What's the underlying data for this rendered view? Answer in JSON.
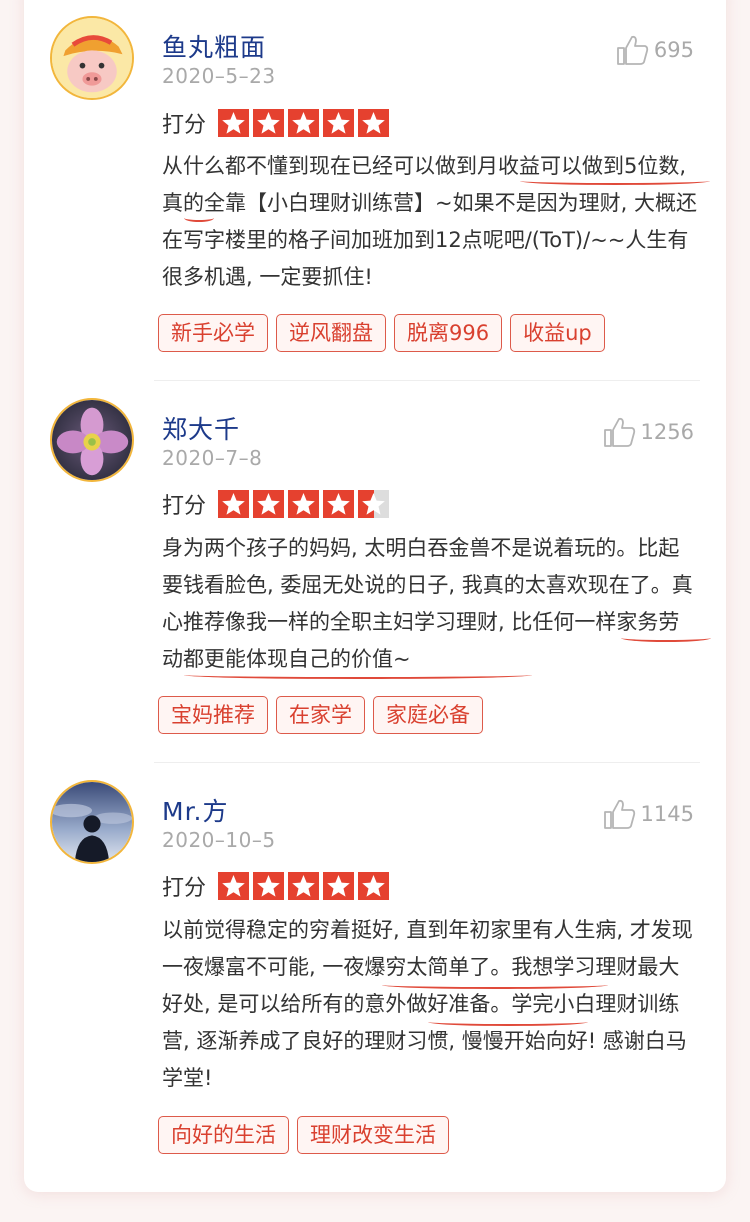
{
  "reviews": [
    {
      "name": "鱼丸粗面",
      "date": "2020–5–23",
      "likes": "695",
      "rating_label": "打分",
      "rating": 5,
      "avatar": "cartoon-pig-avatar",
      "text": "从什么都不懂到现在已经可以做到月收益可以做到5位数, 真的全靠【小白理财训练营】~如果不是因为理财, 大概还在写字楼里的格子间加班加到12点呢吧/(ToT)/~~人生有很多机遇, 一定要抓住!",
      "tags": [
        "新手必学",
        "逆风翻盘",
        "脱离996",
        "收益up"
      ]
    },
    {
      "name": "郑大千",
      "date": "2020–7–8",
      "likes": "1256",
      "rating_label": "打分",
      "rating": 4.5,
      "avatar": "purple-flower-avatar",
      "text": "身为两个孩子的妈妈, 太明白吞金兽不是说着玩的。比起要钱看脸色, 委屈无处说的日子, 我真的太喜欢现在了。真心推荐像我一样的全职主妇学习理财, 比任何一样家务劳动都更能体现自己的价值~",
      "tags": [
        "宝妈推荐",
        "在家学",
        "家庭必备"
      ]
    },
    {
      "name": "Mr.方",
      "date": "2020–10–5",
      "likes": "1145",
      "rating_label": "打分",
      "rating": 5,
      "avatar": "silhouette-sky-avatar",
      "text": "以前觉得稳定的穷着挺好, 直到年初家里有人生病, 才发现一夜爆富不可能, 一夜爆穷太简单了。我想学习理财最大好处, 是可以给所有的意外做好准备。学完小白理财训练营, 逐渐养成了良好的理财习惯, 慢慢开始向好! 感谢白马学堂!",
      "tags": [
        "向好的生活",
        "理财改变生活"
      ]
    }
  ],
  "colors": {
    "accent_red": "#e5412f",
    "name_blue": "#1d3a8a",
    "muted_gray": "#a9a9a9",
    "avatar_border": "#f2b63c"
  }
}
